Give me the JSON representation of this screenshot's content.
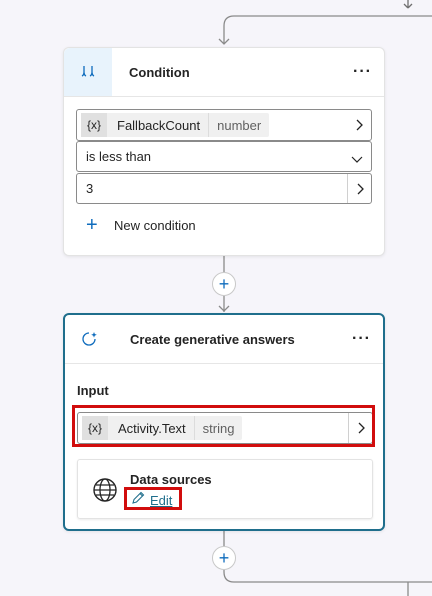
{
  "condition_card": {
    "title": "Condition",
    "variable": {
      "badge": "{x}",
      "name": "FallbackCount",
      "type": "number"
    },
    "operator": "is less than",
    "value": "3",
    "new_condition_label": "New condition"
  },
  "generative_card": {
    "title": "Create generative answers",
    "input_label": "Input",
    "input_variable": {
      "badge": "{x}",
      "name": "Activity.Text",
      "type": "string"
    },
    "data_sources_label": "Data sources",
    "edit_label": "Edit"
  },
  "colors": {
    "accent": "#0f6cbd",
    "selected_border": "#1f6e8c",
    "highlight": "#d10d0d"
  }
}
